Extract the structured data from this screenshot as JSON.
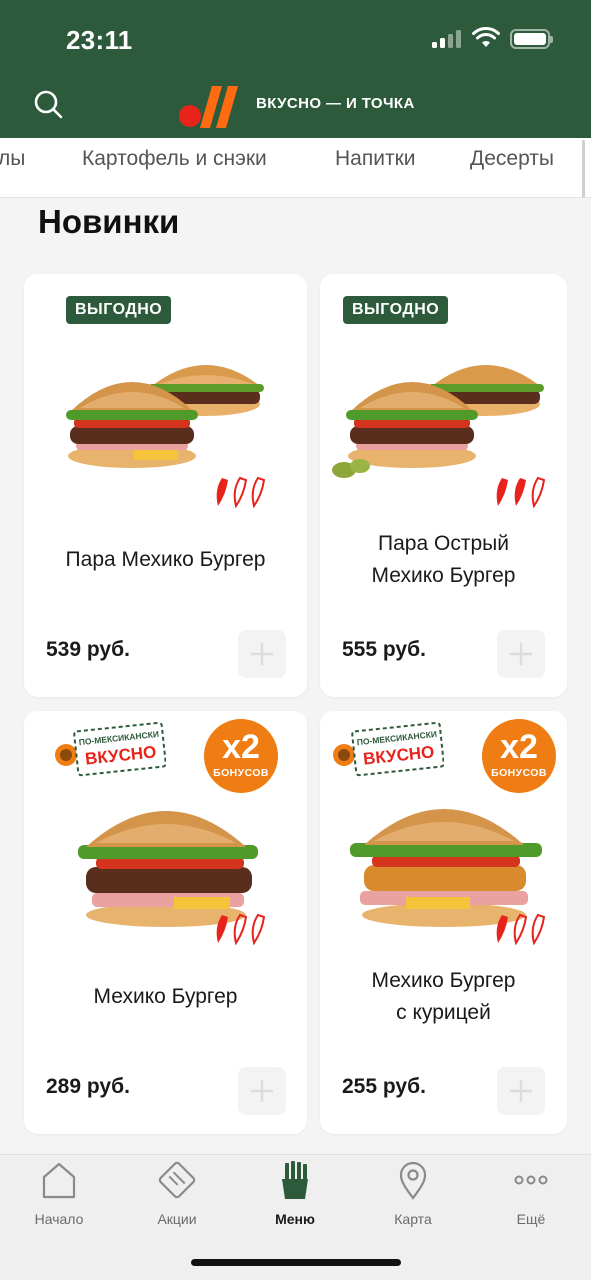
{
  "status_bar": {
    "time": "23:11"
  },
  "header": {
    "brand_text": "ВКУСНО — И ТОЧКА",
    "search_icon": "search-icon",
    "logo_icon": "brand-logo-icon"
  },
  "tabs": [
    {
      "label": "лы"
    },
    {
      "label": "Картофель и снэки"
    },
    {
      "label": "Напитки"
    },
    {
      "label": "Десерты"
    }
  ],
  "section": {
    "title": "Новинки"
  },
  "products": [
    {
      "name_line1": "Пара Мехико Бургер",
      "name_line2": "",
      "price": "539 руб.",
      "badge": "ВЫГОДНО",
      "spicy_level": 1
    },
    {
      "name_line1": "Пара Острый",
      "name_line2": "Мехико Бургер",
      "price": "555 руб.",
      "badge": "ВЫГОДНО",
      "spicy_level": 2
    },
    {
      "name_line1": "Мехико Бургер",
      "name_line2": "",
      "price": "289 руб.",
      "promo_top": "ПО-МЕКСИКАНСКИ",
      "promo_main": "ВКУСНО",
      "bonus_big": "x2",
      "bonus_small": "БОНУСОВ",
      "spicy_level": 1
    },
    {
      "name_line1": "Мехико Бургер",
      "name_line2": "с курицей",
      "price": "255 руб.",
      "promo_top": "ПО-МЕКСИКАНСКИ",
      "promo_main": "ВКУСНО",
      "bonus_big": "x2",
      "bonus_small": "БОНУСОВ",
      "spicy_level": 1
    }
  ],
  "bottom_nav": [
    {
      "label": "Начало",
      "icon": "home-icon",
      "active": false
    },
    {
      "label": "Акции",
      "icon": "promo-ticket-icon",
      "active": false
    },
    {
      "label": "Меню",
      "icon": "fries-icon",
      "active": true
    },
    {
      "label": "Карта",
      "icon": "map-pin-icon",
      "active": false
    },
    {
      "label": "Ещё",
      "icon": "more-dots-icon",
      "active": false
    }
  ],
  "colors": {
    "brand_green": "#2e5a3c",
    "accent_orange": "#f07d14",
    "accent_red": "#e8231c",
    "logo_orange": "#ff6a13"
  }
}
